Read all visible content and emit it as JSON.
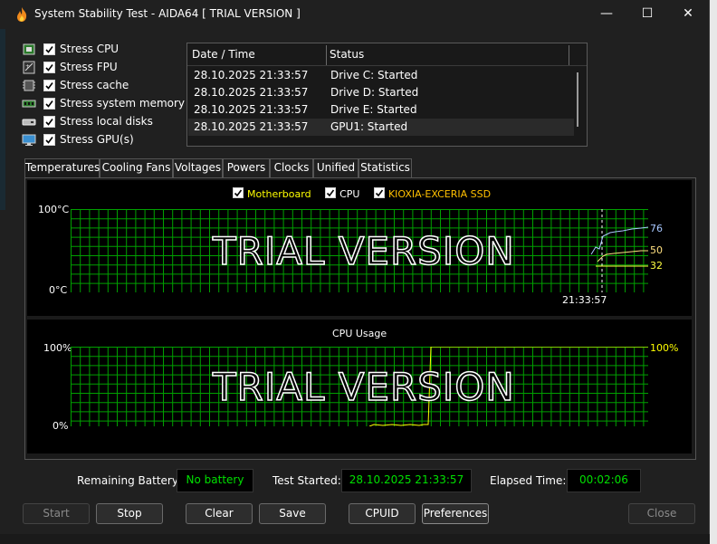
{
  "window": {
    "title": "System Stability Test - AIDA64  [ TRIAL VERSION ]",
    "minimize_glyph": "—",
    "maximize_glyph": "☐",
    "close_glyph": "✕"
  },
  "stress_options": [
    {
      "label": "Stress CPU",
      "checked": true,
      "icon": "cpu-chip-icon"
    },
    {
      "label": "Stress FPU",
      "checked": true,
      "icon": "fpu-chip-icon"
    },
    {
      "label": "Stress cache",
      "checked": true,
      "icon": "cache-chip-icon"
    },
    {
      "label": "Stress system memory",
      "checked": true,
      "icon": "memory-module-icon"
    },
    {
      "label": "Stress local disks",
      "checked": true,
      "icon": "disk-drive-icon"
    },
    {
      "label": "Stress GPU(s)",
      "checked": true,
      "icon": "monitor-gpu-icon"
    }
  ],
  "log": {
    "col_datetime": "Date / Time",
    "col_status": "Status",
    "rows": [
      {
        "datetime": "28.10.2025 21:33:57",
        "status": "Drive C: Started"
      },
      {
        "datetime": "28.10.2025 21:33:57",
        "status": "Drive D: Started"
      },
      {
        "datetime": "28.10.2025 21:33:57",
        "status": "Drive E: Started"
      },
      {
        "datetime": "28.10.2025 21:33:57",
        "status": "GPU1: Started"
      }
    ]
  },
  "tabs": [
    "Temperatures",
    "Cooling Fans",
    "Voltages",
    "Powers",
    "Clocks",
    "Unified",
    "Statistics"
  ],
  "temp_graph": {
    "legend": [
      {
        "label": "Motherboard",
        "color": "#ffff00"
      },
      {
        "label": "CPU",
        "color": "#ffffff"
      },
      {
        "label": "KIOXIA-EXCERIA SSD",
        "color": "#ffc000"
      }
    ],
    "y_max_label": "100°C",
    "y_min_label": "0°C",
    "time_label": "21:33:57",
    "watermark": "TRIAL VERSION",
    "values": [
      {
        "value": "76",
        "color": "#a8c8ff"
      },
      {
        "value": "50",
        "color": "#ffe080"
      },
      {
        "value": "32",
        "color": "#ffff40"
      }
    ]
  },
  "cpu_graph": {
    "title": "CPU Usage",
    "y_max_label": "100%",
    "y_min_label": "0%",
    "watermark": "TRIAL VERSION",
    "current_value": "100%",
    "color": "#ffff00"
  },
  "status": {
    "battery_label": "Remaining Battery:",
    "battery_value": "No battery",
    "started_label": "Test Started:",
    "started_value": "28.10.2025 21:33:57",
    "elapsed_label": "Elapsed Time:",
    "elapsed_value": "00:02:06"
  },
  "buttons": {
    "start": "Start",
    "stop": "Stop",
    "clear": "Clear",
    "save": "Save",
    "cpuid": "CPUID",
    "preferences": "Preferences",
    "close": "Close"
  },
  "colors": {
    "grid": "#00a000",
    "value_box_text": "#00e000"
  }
}
